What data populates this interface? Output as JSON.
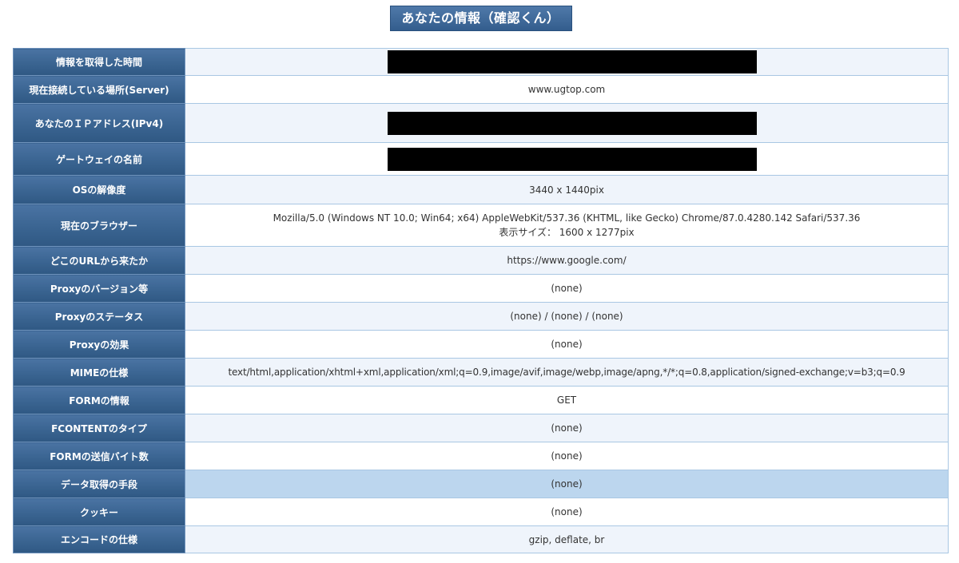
{
  "title": "あなたの情報（確認くん）",
  "rows": [
    {
      "label": "情報を取得した時間",
      "value": ""
    },
    {
      "label": "現在接続している場所(Server)",
      "value": "www.ugtop.com"
    },
    {
      "label": "あなたのＩＰアドレス(IPv4)",
      "value": ""
    },
    {
      "label": "ゲートウェイの名前",
      "value": ""
    },
    {
      "label": "OSの解像度",
      "value": "3440 x 1440pix"
    },
    {
      "label": "現在のブラウザー",
      "value": "Mozilla/5.0 (Windows NT 10.0; Win64; x64) AppleWebKit/537.36 (KHTML, like Gecko) Chrome/87.0.4280.142 Safari/537.36",
      "value2": "表示サイズ： 1600 x 1277pix"
    },
    {
      "label": "どこのURLから来たか",
      "value": "https://www.google.com/"
    },
    {
      "label": "Proxyのバージョン等",
      "value": "(none)"
    },
    {
      "label": "Proxyのステータス",
      "value": "(none) / (none) / (none)"
    },
    {
      "label": "Proxyの効果",
      "value": "(none)"
    },
    {
      "label": "MIMEの仕様",
      "value": "text/html,application/xhtml+xml,application/xml;q=0.9,image/avif,image/webp,image/apng,*/*;q=0.8,application/signed-exchange;v=b3;q=0.9"
    },
    {
      "label": "FORMの情報",
      "value": "GET"
    },
    {
      "label": "FCONTENTのタイプ",
      "value": "(none)"
    },
    {
      "label": "FORMの送信バイト数",
      "value": "(none)"
    },
    {
      "label": "データ取得の手段",
      "value": "(none)"
    },
    {
      "label": "クッキー",
      "value": "(none)"
    },
    {
      "label": "エンコードの仕様",
      "value": "gzip, deflate, br"
    }
  ],
  "colors": {
    "header_bg": "#3a6491",
    "header_text": "#ffffff",
    "row_odd": "#eff4fb",
    "row_even": "#ffffff",
    "row_highlight": "#bcd6ee",
    "border": "#a9c7e3",
    "redaction": "#000000"
  }
}
